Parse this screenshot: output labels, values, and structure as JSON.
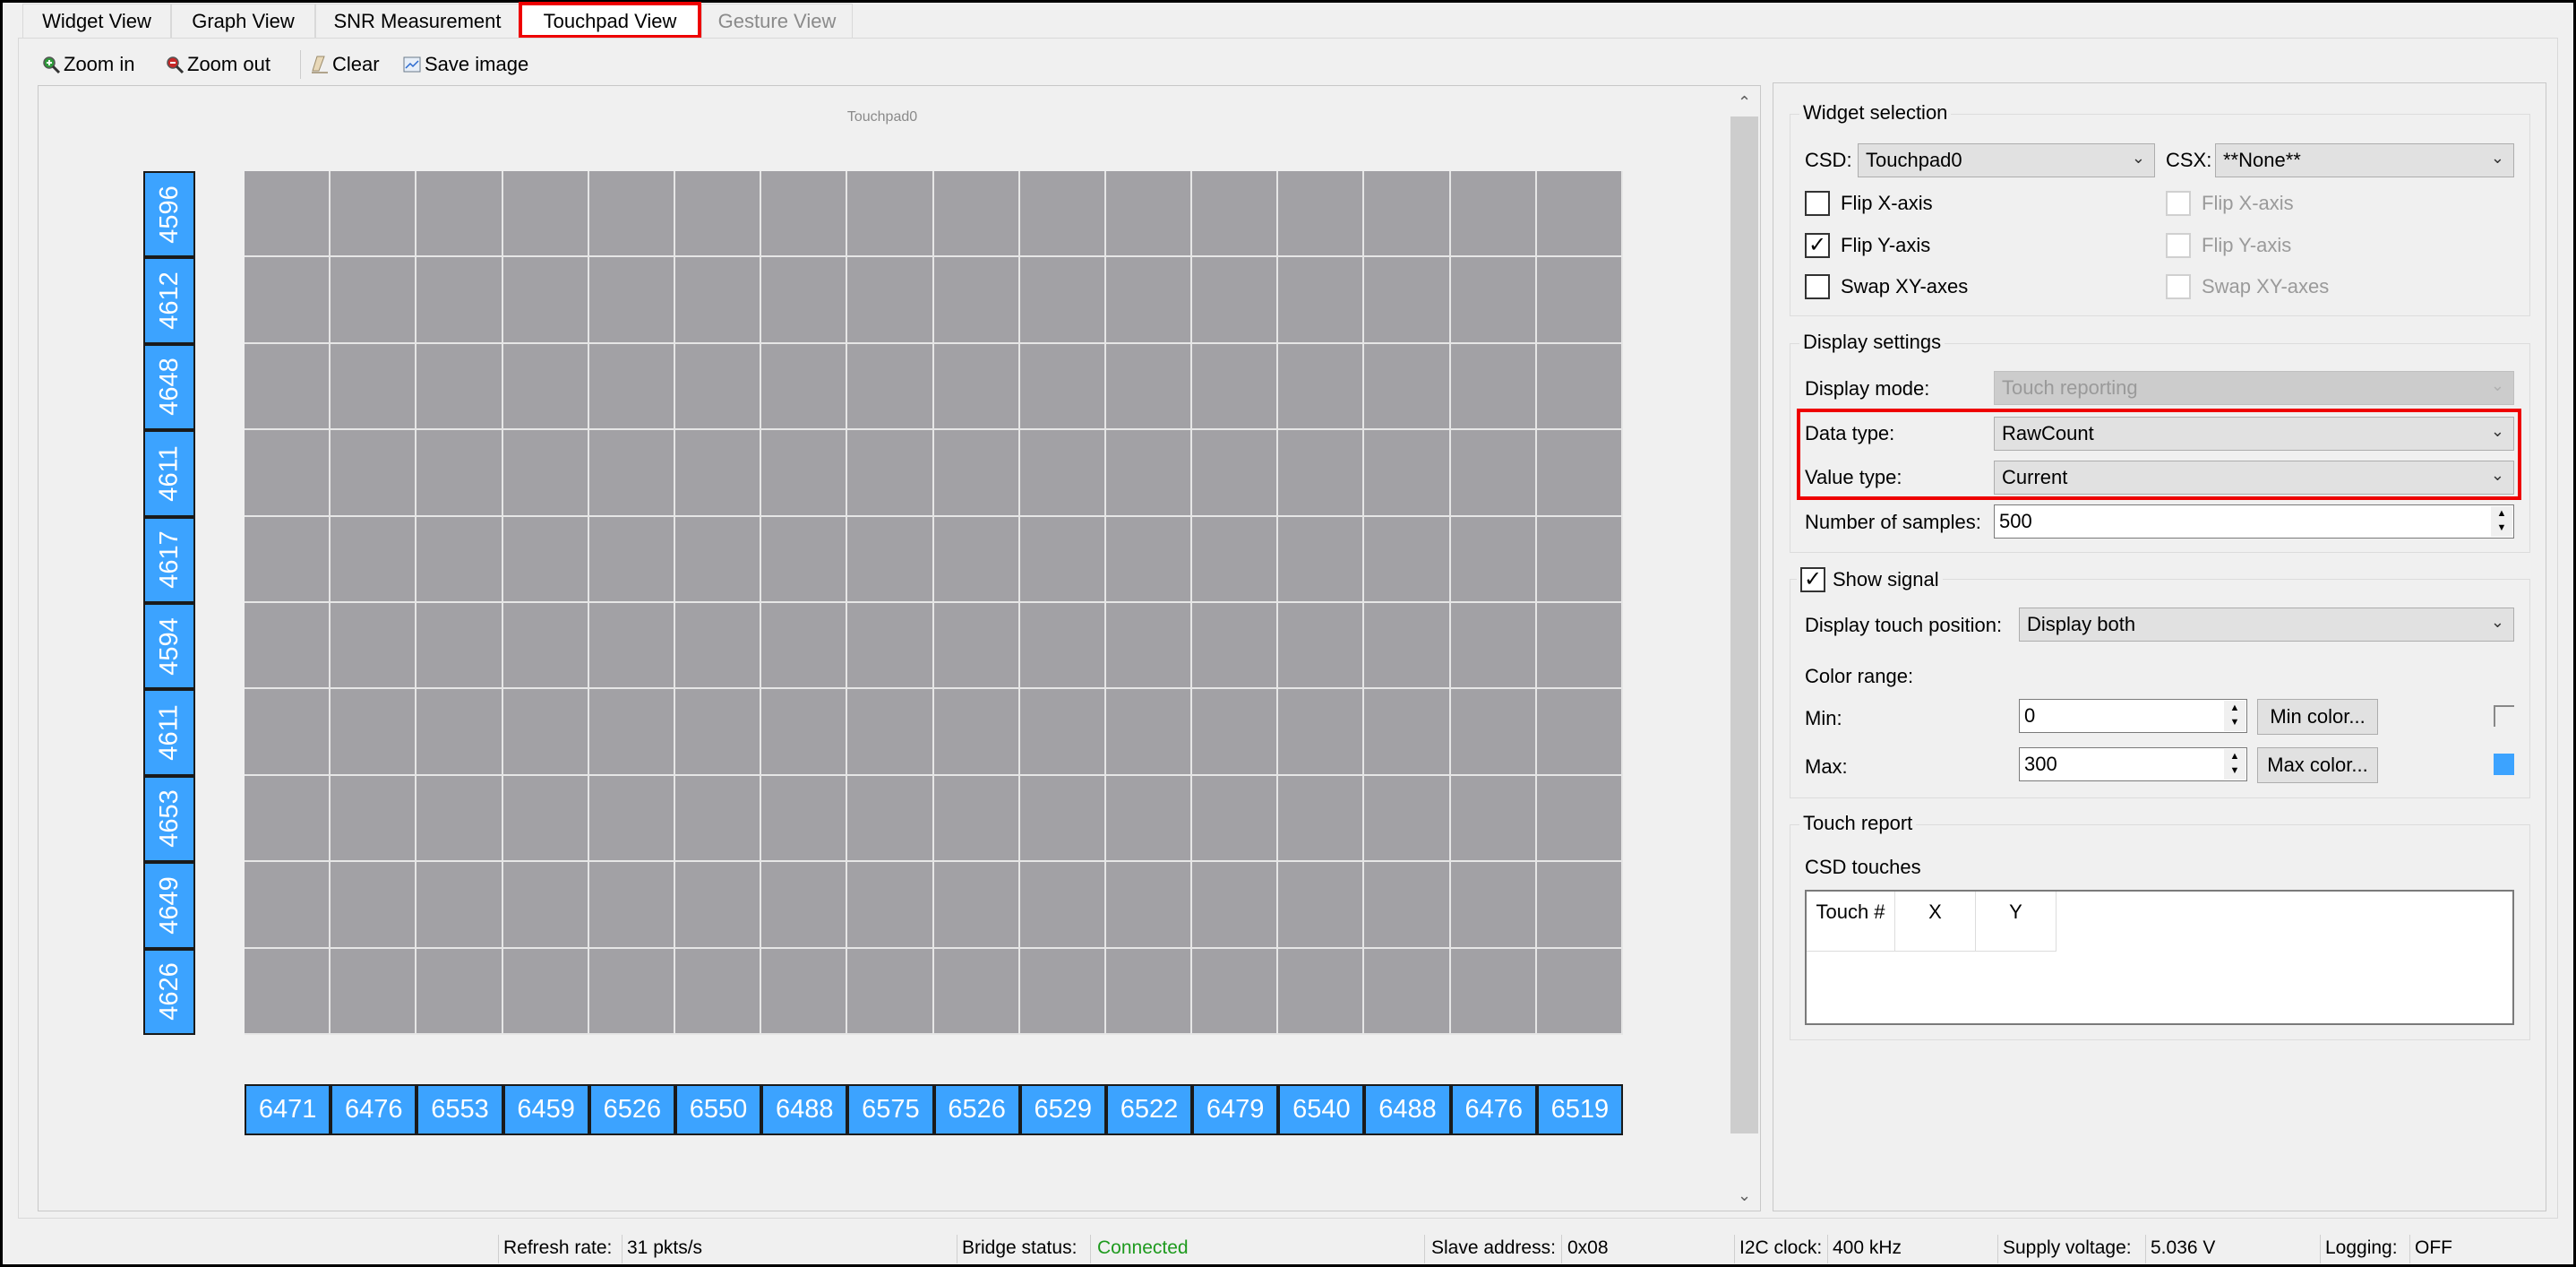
{
  "tabs": [
    {
      "label": "Widget View"
    },
    {
      "label": "Graph View"
    },
    {
      "label": "SNR Measurement"
    },
    {
      "label": "Touchpad View",
      "active": true
    },
    {
      "label": "Gesture View",
      "disabled": true
    }
  ],
  "toolbar": {
    "zoom_in": "Zoom in",
    "zoom_out": "Zoom out",
    "clear": "Clear",
    "save_image": "Save image"
  },
  "touchpad": {
    "title": "Touchpad0",
    "row_values": [
      "4596",
      "4612",
      "4648",
      "4611",
      "4617",
      "4594",
      "4611",
      "4653",
      "4649",
      "4626"
    ],
    "column_values": [
      "6471",
      "6476",
      "6553",
      "6459",
      "6526",
      "6550",
      "6488",
      "6575",
      "6526",
      "6529",
      "6522",
      "6479",
      "6540",
      "6488",
      "6476",
      "6519"
    ],
    "label_color": "#3ca3ff",
    "cell_color": "#a2a1a5"
  },
  "widget_selection": {
    "title": "Widget selection",
    "csd_label": "CSD:",
    "csd_value": "Touchpad0",
    "csx_label": "CSX:",
    "csx_value": "**None**",
    "csd_options": [
      {
        "label": "Flip X-axis",
        "checked": false
      },
      {
        "label": "Flip Y-axis",
        "checked": true
      },
      {
        "label": "Swap XY-axes",
        "checked": false
      }
    ],
    "csx_options": [
      {
        "label": "Flip X-axis",
        "checked": false
      },
      {
        "label": "Flip Y-axis",
        "checked": false
      },
      {
        "label": "Swap XY-axes",
        "checked": false
      }
    ]
  },
  "display_settings": {
    "title": "Display settings",
    "display_mode_label": "Display mode:",
    "display_mode_value": "Touch reporting",
    "data_type_label": "Data type:",
    "data_type_value": "RawCount",
    "value_type_label": "Value type:",
    "value_type_value": "Current",
    "samples_label": "Number of samples:",
    "samples_value": "500"
  },
  "show_signal": {
    "title": "Show signal",
    "checked": true,
    "touch_position_label": "Display touch position:",
    "touch_position_value": "Display both",
    "color_range_label": "Color range:",
    "min_label": "Min:",
    "min_value": "0",
    "min_color_button": "Min color...",
    "max_label": "Max:",
    "max_value": "300",
    "max_color_button": "Max color...",
    "max_color": "#3ca3ff"
  },
  "touch_report": {
    "title": "Touch report",
    "csd_touches_label": "CSD touches",
    "columns": [
      "Touch #",
      "X",
      "Y"
    ]
  },
  "status_bar": {
    "refresh_label": "Refresh rate:",
    "refresh_value": "31 pkts/s",
    "bridge_label": "Bridge status:",
    "bridge_value": "Connected",
    "bridge_color": "#1e9a1e",
    "slave_label": "Slave address:",
    "slave_value": "0x08",
    "i2c_label": "I2C clock:",
    "i2c_value": "400 kHz",
    "supply_label": "Supply voltage:",
    "supply_value": "5.036 V",
    "logging_label": "Logging:",
    "logging_value": "OFF"
  }
}
